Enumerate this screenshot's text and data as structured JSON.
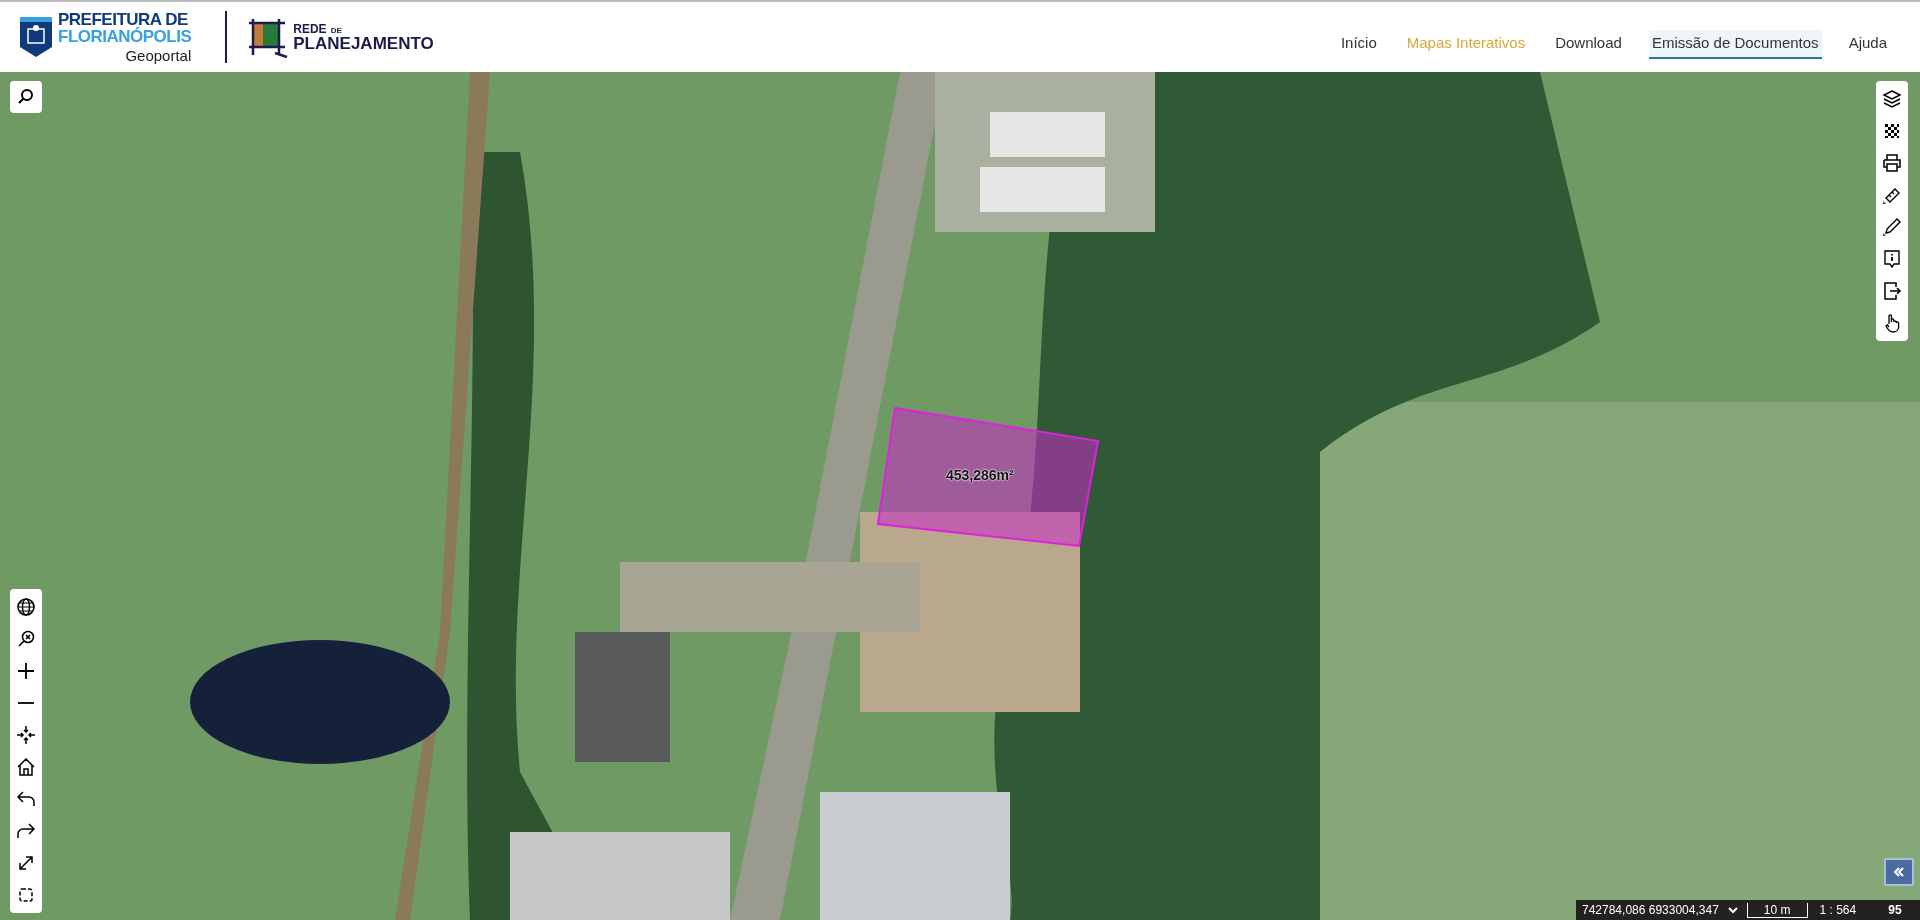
{
  "header": {
    "logo_line_1": "PREFEITURA DE",
    "logo_line_2": "FLORIANÓPOLIS",
    "logo_subtitle": "Geoportal",
    "partner_small": "REDE",
    "partner_small_2": "DE",
    "partner_big": "PLANEJAMENTO"
  },
  "nav": [
    {
      "label": "Início",
      "selected": false,
      "highlighted": false
    },
    {
      "label": "Mapas Interativos",
      "selected": false,
      "highlighted": true
    },
    {
      "label": "Download",
      "selected": false,
      "highlighted": false
    },
    {
      "label": "Emissão de Documentos",
      "selected": true,
      "highlighted": false
    },
    {
      "label": "Ajuda",
      "selected": false,
      "highlighted": false
    }
  ],
  "measurement": {
    "area": "453,286m²"
  },
  "status_bar": {
    "coordinates": "742784,086 6933004,347",
    "scale_bar": "10 m",
    "scale": "1 : 564",
    "cut_text": "95"
  }
}
